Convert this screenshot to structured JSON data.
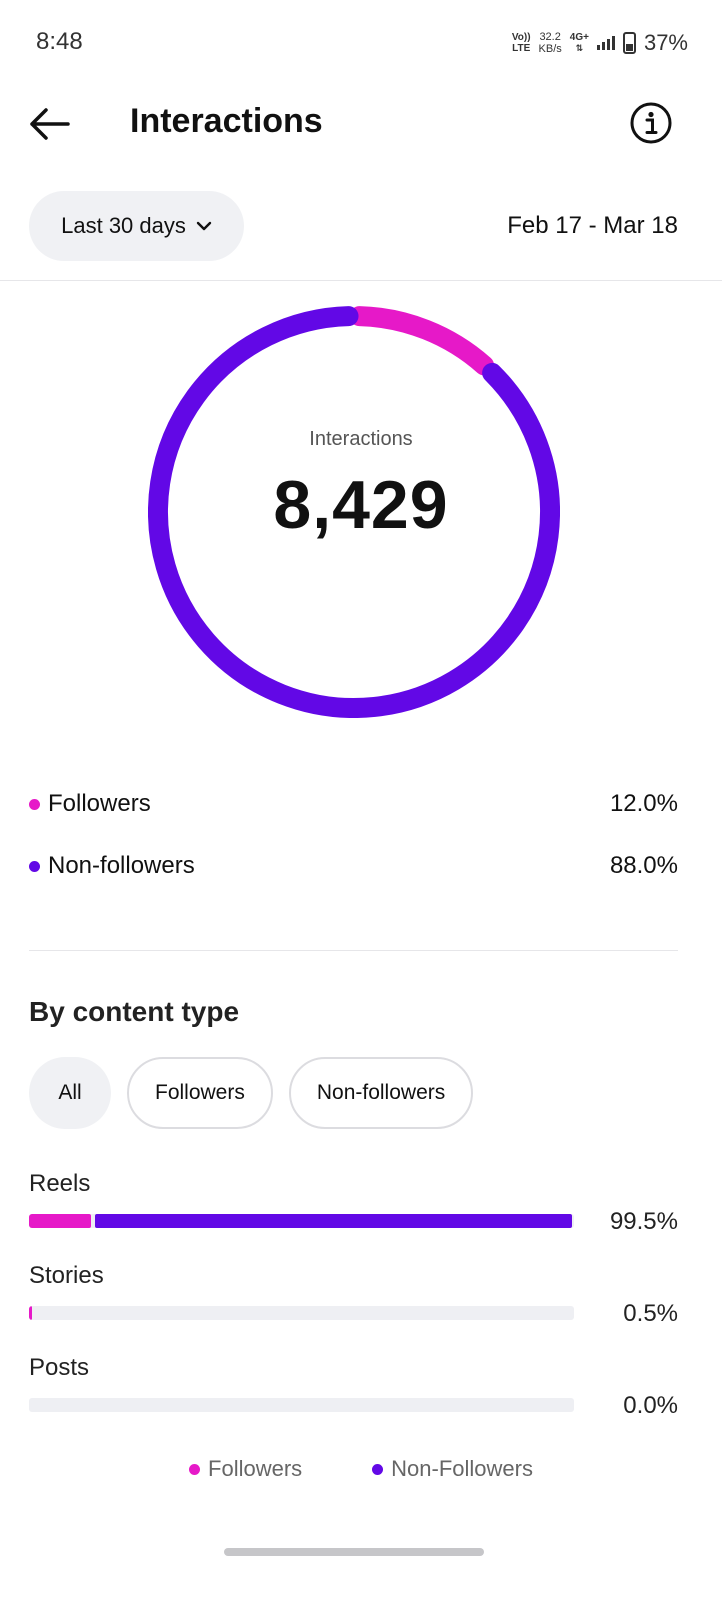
{
  "status_bar": {
    "time": "8:48",
    "volte_top": "Vo))",
    "volte_bottom": "LTE",
    "speed_top": "32.2",
    "speed_bottom": "KB/s",
    "network": "4G+",
    "battery_percent": "37%"
  },
  "header": {
    "title": "Interactions",
    "back_icon": "arrow-left-icon",
    "info_icon": "info-circle-icon"
  },
  "filters": {
    "range_label": "Last 30 days",
    "date_range": "Feb 17 - Mar 18"
  },
  "summary": {
    "label": "Interactions",
    "value": "8,429"
  },
  "colors": {
    "followers": "#e619c8",
    "non_followers": "#6208e6",
    "track": "#eeeff3"
  },
  "audience": [
    {
      "label": "Followers",
      "percent": "12.0%",
      "value": 12.0,
      "color": "#e619c8"
    },
    {
      "label": "Non-followers",
      "percent": "88.0%",
      "value": 88.0,
      "color": "#6208e6"
    }
  ],
  "content_type": {
    "title": "By content type",
    "chips": [
      {
        "label": "All",
        "active": true
      },
      {
        "label": "Followers",
        "active": false
      },
      {
        "label": "Non-followers",
        "active": false
      }
    ],
    "rows": [
      {
        "label": "Reels",
        "percent": "99.5%",
        "total": 99.5,
        "followers_share": 11.4,
        "non_followers_share": 88.1
      },
      {
        "label": "Stories",
        "percent": "0.5%",
        "total": 0.5,
        "followers_share": 0.5,
        "non_followers_share": 0
      },
      {
        "label": "Posts",
        "percent": "0.0%",
        "total": 0.0,
        "followers_share": 0,
        "non_followers_share": 0
      }
    ]
  },
  "bottom_legend": {
    "followers": "Followers",
    "non_followers": "Non-Followers"
  }
}
